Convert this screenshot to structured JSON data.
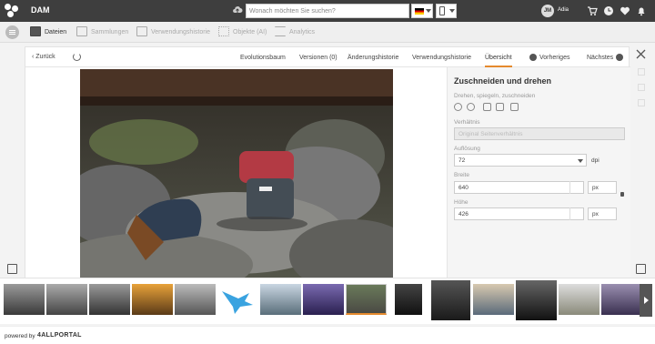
{
  "app": {
    "brand": "DAM",
    "search_placeholder": "Wonach möchten Sie suchen?",
    "user_initials": "JM",
    "user_name": "Adia"
  },
  "nav": {
    "tabs": [
      {
        "label": "Dateien",
        "active": true
      },
      {
        "label": "Sammlungen"
      },
      {
        "label": "Verwendungshistorie"
      },
      {
        "label": "Objekte (AI)"
      },
      {
        "label": "Analytics"
      }
    ]
  },
  "detail": {
    "back_label": "Zurück",
    "tabs": [
      "Evolutionsbaum",
      "Versionen (0)",
      "Änderungshistorie",
      "Verwendungshistorie",
      "Übersicht"
    ],
    "prev_label": "Vorheriges",
    "next_label": "Nächstes"
  },
  "crop": {
    "title": "Zuschneiden und drehen",
    "tools_label": "Drehen, spiegeln, zuschneiden",
    "ratio_label": "Verhältnis",
    "ratio_value": "Original Seitenverhältnis",
    "resolution_label": "Auflösung",
    "resolution_value": "72",
    "resolution_unit": "dpi",
    "width_label": "Breite",
    "width_value": "640",
    "width_unit": "px",
    "height_label": "Höhe",
    "height_value": "426",
    "height_unit": "px"
  },
  "footer": {
    "powered_by": "powered by",
    "vendor": "4ALLPORTAL"
  }
}
